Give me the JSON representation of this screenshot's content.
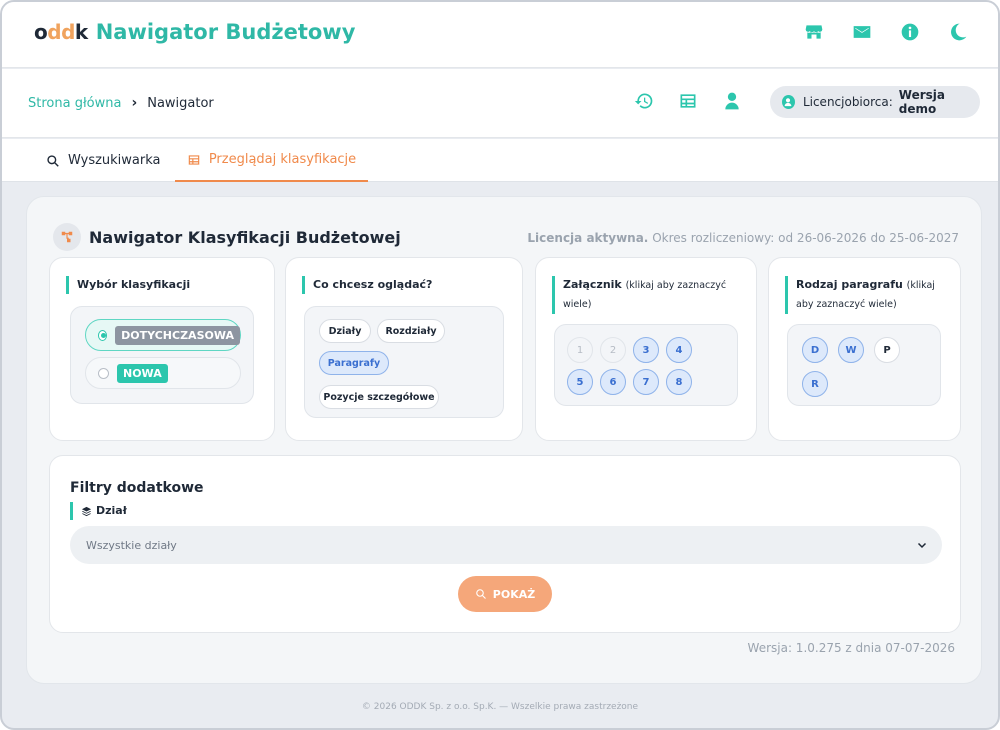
{
  "header": {
    "logo_text_a": "o",
    "logo_text_dots": "dd",
    "logo_text_b": "k",
    "title": "Nawigator Budżetowy",
    "icons": [
      "store-icon",
      "mail-icon",
      "info-icon",
      "moon-icon"
    ]
  },
  "breadcrumb": {
    "home": "Strona główna",
    "separator": "›",
    "current": "Nawigator"
  },
  "licence_pill": {
    "label": "Licencjobiorca:",
    "value": "Wersja demo"
  },
  "tabs": [
    {
      "label": "Wyszukiwarka",
      "active": false
    },
    {
      "label": "Przeglądaj klasyfikacje",
      "active": true
    }
  ],
  "main": {
    "title": "Nawigator Klasyfikacji Budżetowej",
    "licence_status": "Licencja aktywna.",
    "licence_period": "Okres rozliczeniowy: od 26-06-2026 do 25-06-2027"
  },
  "classification": {
    "label": "Wybór klasyfikacji",
    "options": [
      {
        "label": "DOTYCHCZASOWA",
        "selected": true
      },
      {
        "label": "NOWA",
        "selected": false
      }
    ]
  },
  "view": {
    "label": "Co chcesz oglądać?",
    "chips": [
      {
        "label": "Działy",
        "active": false
      },
      {
        "label": "Rozdziały",
        "active": false
      },
      {
        "label": "Paragrafy",
        "active": true
      },
      {
        "label": "Pozycje szczegółowe",
        "active": false
      }
    ]
  },
  "attachment": {
    "label": "Załącznik",
    "hint": "(klikaj aby zaznaczyć wiele)",
    "items": [
      {
        "label": "1",
        "state": "off"
      },
      {
        "label": "2",
        "state": "off"
      },
      {
        "label": "3",
        "state": "on"
      },
      {
        "label": "4",
        "state": "on"
      },
      {
        "label": "5",
        "state": "on"
      },
      {
        "label": "6",
        "state": "on"
      },
      {
        "label": "7",
        "state": "on"
      },
      {
        "label": "8",
        "state": "on"
      }
    ]
  },
  "paragraph_type": {
    "label": "Rodzaj paragrafu",
    "hint": "(klikaj aby zaznaczyć wiele)",
    "items": [
      {
        "label": "D",
        "state": "on"
      },
      {
        "label": "W",
        "state": "on"
      },
      {
        "label": "P",
        "state": "plain"
      },
      {
        "label": "R",
        "state": "on"
      }
    ]
  },
  "filters": {
    "title": "Filtry dodatkowe",
    "field_label": "Dział",
    "select_value": "Wszystkie działy",
    "button_label": "POKAŻ"
  },
  "version": "Wersja: 1.0.275 z dnia 07-07-2026",
  "footer": "© 2026 ODDK Sp. z o.o. Sp.K. — Wszelkie prawa zastrzeżone",
  "colors": {
    "accent": "#2cc6ad",
    "orange": "#f08a4b",
    "button": "#f5a77a"
  }
}
